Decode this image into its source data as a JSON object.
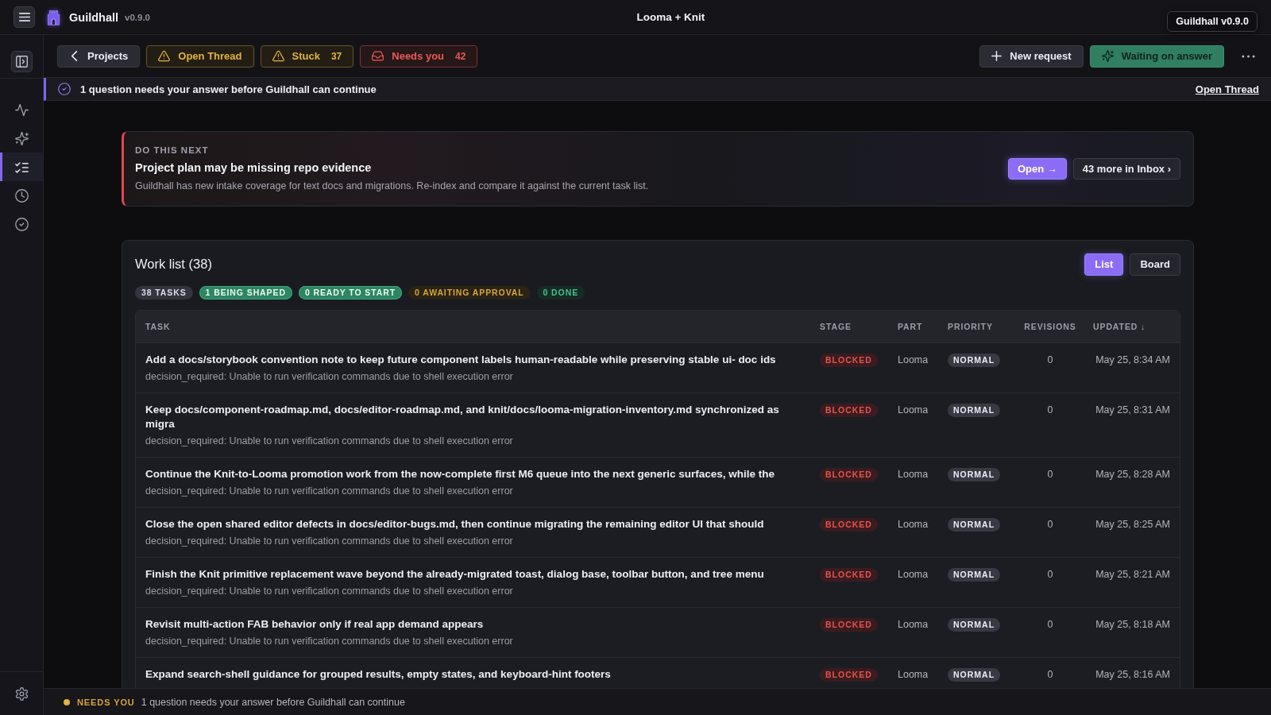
{
  "app": {
    "name": "Guildhall",
    "version": "v0.9.0"
  },
  "window": {
    "title": "Looma + Knit"
  },
  "tooltip": {
    "text": "Guildhall v0.9.0"
  },
  "sidebar": {
    "items": [
      {
        "selected": false
      },
      {
        "selected": false
      },
      {
        "selected": true
      },
      {
        "selected": false
      },
      {
        "selected": false
      }
    ]
  },
  "toolbar": {
    "left": [
      {
        "kind": "back",
        "label": "Projects"
      },
      {
        "kind": "warning",
        "label": "Open Thread"
      },
      {
        "kind": "warning",
        "label": "Stuck",
        "count": "37"
      },
      {
        "kind": "danger",
        "label": "Needs you",
        "count": "42"
      }
    ],
    "right": [
      {
        "kind": "default",
        "label": "New request"
      },
      {
        "kind": "success",
        "label": "Waiting on answer"
      }
    ]
  },
  "banner": {
    "message": "1 question needs your answer before Guildhall can continue",
    "link": "Open Thread"
  },
  "next_card": {
    "eyebrow": "DO THIS NEXT",
    "title": "Project plan may be missing repo evidence",
    "description": "Guildhall has new intake coverage for text docs and migrations. Re-index and compare it against the current task list.",
    "actions": [
      {
        "kind": "primary",
        "label": "Open →"
      },
      {
        "kind": "secondary",
        "label": "43 more in Inbox ›"
      }
    ]
  },
  "work_list": {
    "title": "Work list (38)",
    "views": [
      {
        "label": "List",
        "selected": true
      },
      {
        "label": "Board",
        "selected": false
      }
    ],
    "summary": [
      {
        "kind": "neutral",
        "label": "38 TASKS"
      },
      {
        "kind": "success",
        "label": "1 BEING SHAPED"
      },
      {
        "kind": "success",
        "label": "0 READY TO START"
      },
      {
        "kind": "warning",
        "label": "0 AWAITING APPROVAL"
      },
      {
        "kind": "muted",
        "label": "0 DONE"
      }
    ],
    "table": {
      "columns": [
        "TASK",
        "STAGE",
        "PART",
        "PRIORITY",
        "REVISIONS",
        "UPDATED ↓"
      ],
      "rows": [
        {
          "task": "Add a docs/storybook convention note to keep future component labels human-readable while preserving stable ui- doc ids",
          "detail": "decision_required: Unable to run verification commands due to shell execution error",
          "stage": "BLOCKED",
          "part": "Looma",
          "priority": "NORMAL",
          "revisions": "0",
          "updated": "May 25, 8:34 AM"
        },
        {
          "task": "Keep docs/component-roadmap.md, docs/editor-roadmap.md, and knit/docs/looma-migration-inventory.md synchronized as migra",
          "detail": "decision_required: Unable to run verification commands due to shell execution error",
          "stage": "BLOCKED",
          "part": "Looma",
          "priority": "NORMAL",
          "revisions": "0",
          "updated": "May 25, 8:31 AM"
        },
        {
          "task": "Continue the Knit-to-Looma promotion work from the now-complete first M6 queue into the next generic surfaces, while the",
          "detail": "decision_required: Unable to run verification commands due to shell execution error",
          "stage": "BLOCKED",
          "part": "Looma",
          "priority": "NORMAL",
          "revisions": "0",
          "updated": "May 25, 8:28 AM"
        },
        {
          "task": "Close the open shared editor defects in docs/editor-bugs.md, then continue migrating the remaining editor UI that should",
          "detail": "decision_required: Unable to run verification commands due to shell execution error",
          "stage": "BLOCKED",
          "part": "Looma",
          "priority": "NORMAL",
          "revisions": "0",
          "updated": "May 25, 8:25 AM"
        },
        {
          "task": "Finish the Knit primitive replacement wave beyond the already-migrated toast, dialog base, toolbar button, and tree menu",
          "detail": "decision_required: Unable to run verification commands due to shell execution error",
          "stage": "BLOCKED",
          "part": "Looma",
          "priority": "NORMAL",
          "revisions": "0",
          "updated": "May 25, 8:21 AM"
        },
        {
          "task": "Revisit multi-action FAB behavior only if real app demand appears",
          "detail": "decision_required: Unable to run verification commands due to shell execution error",
          "stage": "BLOCKED",
          "part": "Looma",
          "priority": "NORMAL",
          "revisions": "0",
          "updated": "May 25, 8:18 AM"
        },
        {
          "task": "Expand search-shell guidance for grouped results, empty states, and keyboard-hint footers",
          "stage": "BLOCKED",
          "part": "Looma",
          "priority": "NORMAL",
          "revisions": "0",
          "updated": "May 25, 8:16 AM"
        }
      ]
    }
  },
  "status_bar": {
    "label": "NEEDS YOU",
    "message": "1 question needs your answer before Guildhall can continue"
  }
}
